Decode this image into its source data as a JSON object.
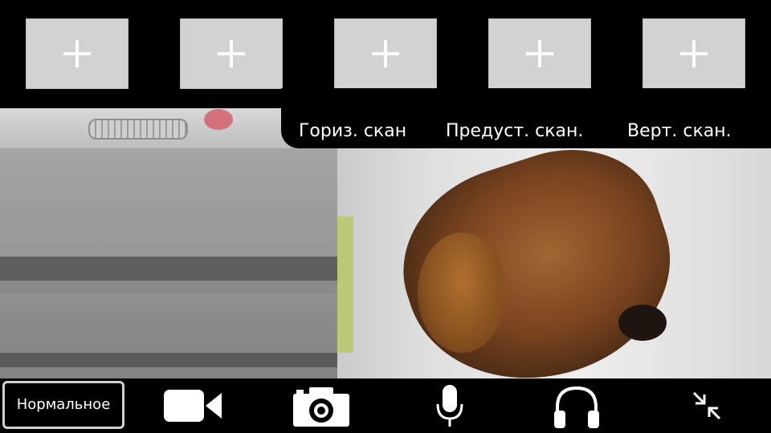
{
  "presets": [
    {
      "id": 1,
      "state": "empty",
      "icon": "plus-icon"
    },
    {
      "id": 2,
      "state": "empty",
      "icon": "plus-icon"
    },
    {
      "id": 3,
      "state": "empty",
      "icon": "plus-icon"
    },
    {
      "id": 4,
      "state": "empty",
      "icon": "plus-icon"
    },
    {
      "id": 5,
      "state": "empty",
      "icon": "plus-icon"
    }
  ],
  "scan": {
    "horizontal": "Гориз. скан",
    "preset": "Предуст. скан.",
    "vertical": "Верт. скан."
  },
  "toolbar": {
    "mode_label": "Нормальное",
    "icons": [
      "video-camera-icon",
      "camera-icon",
      "microphone-icon",
      "headphones-icon",
      "collapse-icon"
    ]
  },
  "colors": {
    "preset_slot": "#d2d2d2",
    "bar_background": "#000000",
    "icon": "#ffffff"
  }
}
